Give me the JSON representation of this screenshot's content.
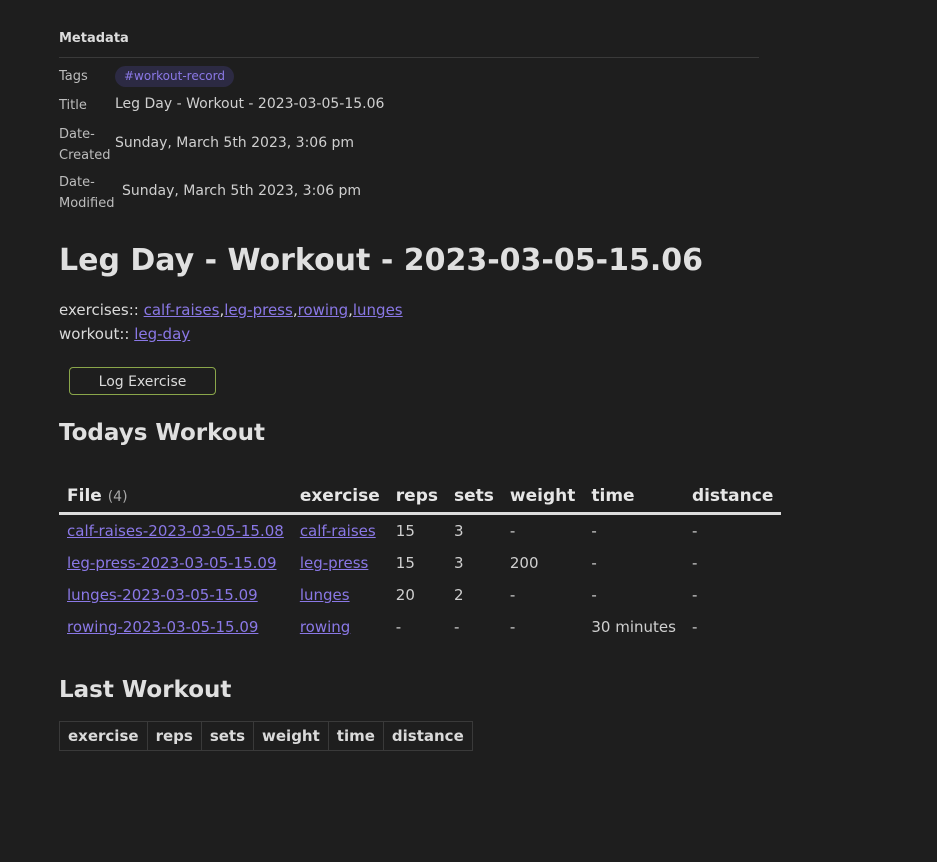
{
  "metadata": {
    "heading": "Metadata",
    "tags_label": "Tags",
    "tag": "#workout-record",
    "title_label": "Title",
    "title_value": "Leg Day - Workout - 2023-03-05-15.06",
    "created_label_1": "Date-",
    "created_label_2": "Created",
    "created_value": "Sunday, March 5th 2023, 3:06 pm",
    "modified_label_1": "Date-",
    "modified_label_2": "Modified",
    "modified_value": "Sunday, March 5th 2023, 3:06 pm"
  },
  "page_title": "Leg Day - Workout - 2023-03-05-15.06",
  "properties": {
    "exercises_label": "exercises::",
    "exercises": [
      "calf-raises",
      "leg-press",
      "rowing",
      "lunges"
    ],
    "separator": ",",
    "workout_label": "workout::",
    "workout": "leg-day"
  },
  "log_button": "Log Exercise",
  "todays_workout": {
    "heading": "Todays Workout",
    "columns": [
      "File",
      "exercise",
      "reps",
      "sets",
      "weight",
      "time",
      "distance"
    ],
    "count": "(4)",
    "rows": [
      [
        "calf-raises-2023-03-05-15.08",
        "calf-raises",
        "15",
        "3",
        "-",
        "-",
        "-"
      ],
      [
        "leg-press-2023-03-05-15.09",
        "leg-press",
        "15",
        "3",
        "200",
        "-",
        "-"
      ],
      [
        "lunges-2023-03-05-15.09",
        "lunges",
        "20",
        "2",
        "-",
        "-",
        "-"
      ],
      [
        "rowing-2023-03-05-15.09",
        "rowing",
        "-",
        "-",
        "-",
        "30 minutes",
        "-"
      ]
    ]
  },
  "last_workout": {
    "heading": "Last Workout",
    "columns": [
      "exercise",
      "reps",
      "sets",
      "weight",
      "time",
      "distance"
    ]
  },
  "colors": {
    "background": "#1e1e1e",
    "link": "#8a78e6",
    "button_border": "#8aa64a",
    "tag_background": "#2c2a43"
  }
}
